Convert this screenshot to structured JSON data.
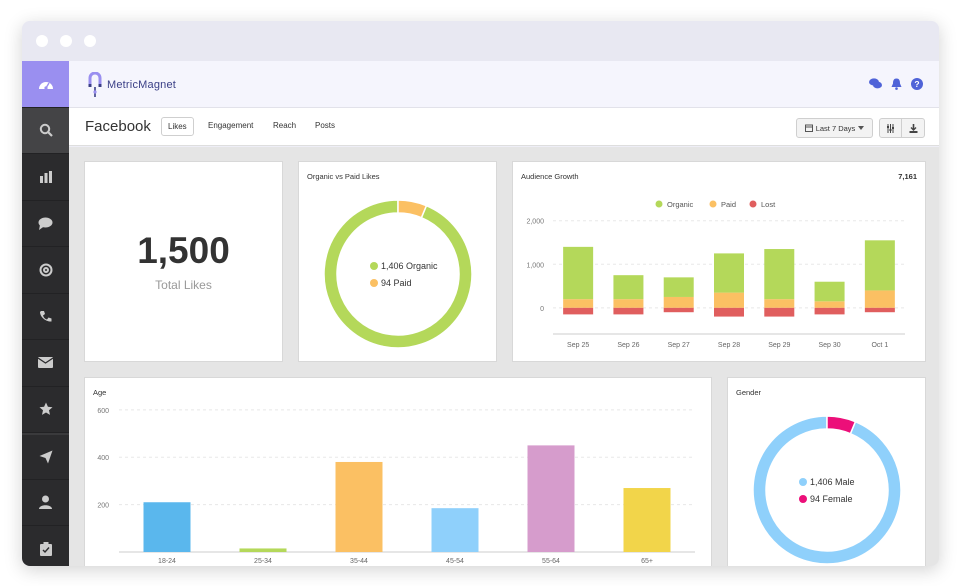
{
  "app": {
    "brand": "MetricMagnet"
  },
  "header": {
    "title": "Facebook"
  },
  "tabs": [
    {
      "label": "Likes",
      "active": true
    },
    {
      "label": "Engagement",
      "active": false
    },
    {
      "label": "Reach",
      "active": false
    },
    {
      "label": "Posts",
      "active": false
    }
  ],
  "toolbar": {
    "date_range": "Last 7 Days"
  },
  "sidebar": {
    "items": [
      "dashboard-icon",
      "search-icon",
      "bar-chart-icon",
      "comment-icon",
      "at-icon",
      "phone-icon",
      "envelope-icon",
      "star-icon",
      "paper-plane-icon",
      "user-icon",
      "clipboard-icon"
    ]
  },
  "total_likes": {
    "value": "1,500",
    "label": "Total Likes"
  },
  "colors": {
    "organic": "#b4d85a",
    "paid": "#fbc063",
    "lost": "#e05e5e",
    "male": "#8fd0fb",
    "female": "#ec0f79",
    "accent": "#9a8ff0"
  },
  "chart_data": [
    {
      "type": "pie",
      "title": "Organic vs Paid Likes",
      "labels": [
        "Organic",
        "Paid"
      ],
      "values": [
        1406,
        94
      ],
      "legend": [
        "1,406 Organic",
        "94 Paid"
      ]
    },
    {
      "type": "bar",
      "title": "Audience Growth",
      "total": "7,161",
      "categories": [
        "Sep 25",
        "Sep 26",
        "Sep 27",
        "Sep 28",
        "Sep 29",
        "Sep 30",
        "Oct 1"
      ],
      "series": [
        {
          "name": "Organic",
          "values": [
            1200,
            550,
            450,
            900,
            1150,
            450,
            1150
          ]
        },
        {
          "name": "Paid",
          "values": [
            200,
            200,
            250,
            350,
            200,
            150,
            400
          ]
        },
        {
          "name": "Lost",
          "values": [
            -150,
            -150,
            -100,
            -200,
            -200,
            -150,
            -100
          ]
        }
      ],
      "ylim": [
        -600,
        2200
      ],
      "yticks": [
        "2,000",
        "1,000",
        "0"
      ]
    },
    {
      "type": "bar",
      "title": "Age",
      "categories": [
        "18-24",
        "25-34",
        "35-44",
        "45-54",
        "55-64",
        "65+"
      ],
      "values": [
        210,
        15,
        380,
        185,
        450,
        270
      ],
      "colors": [
        "#5ab7ed",
        "#b4d85a",
        "#fbc063",
        "#8fd0fb",
        "#d69ccc",
        "#f2d54a"
      ],
      "ylim": [
        0,
        650
      ],
      "yticks": [
        "600",
        "400",
        "200"
      ]
    },
    {
      "type": "pie",
      "title": "Gender",
      "labels": [
        "Male",
        "Female"
      ],
      "values": [
        1406,
        94
      ],
      "legend": [
        "1,406 Male",
        "94 Female"
      ]
    }
  ]
}
